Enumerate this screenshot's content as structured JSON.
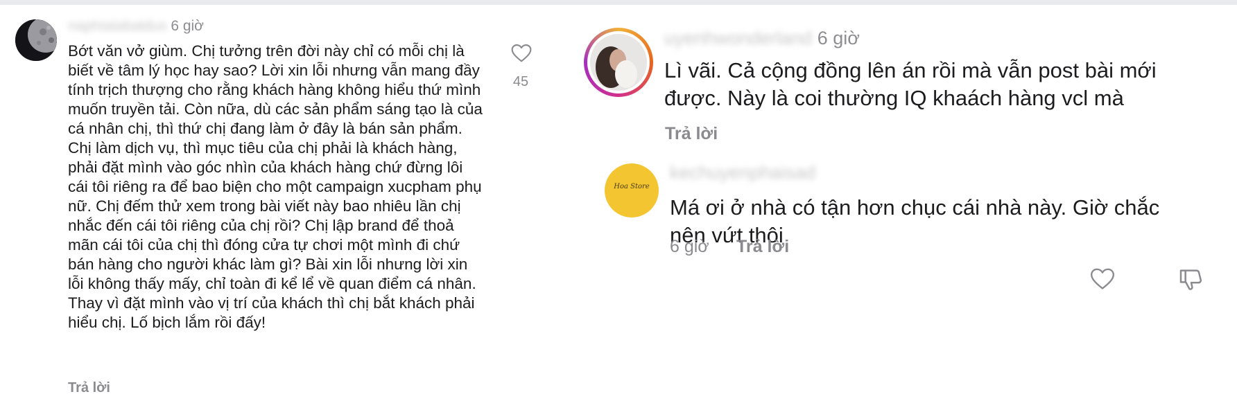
{
  "colors": {
    "text": "#1c1c1e",
    "muted": "#8a8a8f",
    "story_ring_start": "#f0b23a",
    "story_ring_end": "#d1308c",
    "avatar_yellow": "#f2c531"
  },
  "left_comment": {
    "username": "naphtalabaldus",
    "time": "6 giờ",
    "text": "Bớt văn vở giùm. Chị tưởng trên đời này chỉ có mỗi chị là biết về tâm lý học hay sao? Lời xin lỗi nhưng vẫn mang đầy tính trịch thượng cho rằng khách hàng không hiểu thứ mình muốn truyền tải. Còn nữa, dù các sản phẩm sáng tạo là của cá nhân chị, thì thứ chị đang làm ở đây là bán sản phẩm. Chị làm dịch vụ, thì mục tiêu của chị phải là khách hàng, phải đặt mình vào góc nhìn của khách hàng chứ đừng lôi cái tôi riêng ra để bao biện cho một campaign xucpham phụ nữ. Chị đếm thử xem trong bài viết này bao nhiêu lần chị nhắc đến cái tôi riêng của chị rồi? Chị lập brand để thoả mãn cái tôi của chị thì đóng cửa tự chơi một mình đi chứ bán hàng cho người khác làm gì? Bài xin lỗi nhưng lời xin lỗi không thấy mấy, chỉ toàn đi kể lể về quan điểm cá nhân. Thay vì đặt mình vào vị trí của khách thì chị bắt khách phải hiểu chị. Lố bịch lắm rồi đấy!",
    "reply_label": "Trả lời",
    "like_icon": "heart-outline-icon",
    "like_count": "45"
  },
  "right_comment": {
    "username": "uyenhwonderland",
    "time": "6 giờ",
    "text": "Lì vãi. Cả cộng đồng lên án rồi mà vẫn post bài mới được. Này là coi thường IQ khaách hàng vcl mà",
    "reply_label": "Trả lời"
  },
  "nested_reply": {
    "username": "kechuyenphaisad",
    "avatar_logo_text": "Hoa Store",
    "text": "Má ơi ở nhà có tận hơn chục cái nhà này. Giờ chắc nên vứt thôi",
    "time": "6 giờ",
    "reply_label": "Trả lời",
    "like_icon": "heart-outline-icon",
    "dislike_icon": "thumbs-down-icon"
  }
}
